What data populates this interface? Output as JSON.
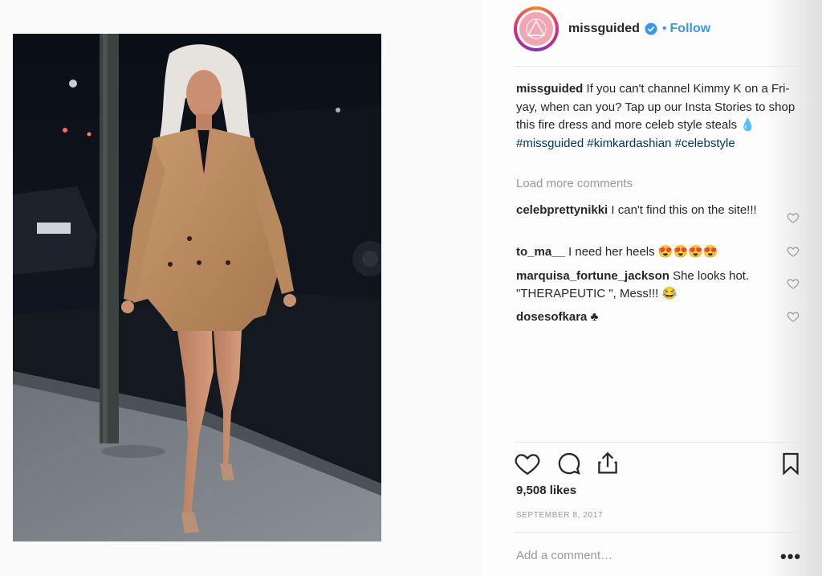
{
  "post": {
    "username": "missguided",
    "follow_label": "Follow",
    "separator": "•",
    "caption": {
      "username": "missguided",
      "text": " If you can't channel Kimmy K on a Fri-yay, when can you? Tap up our Insta Stories to shop this fire dress and more celeb style steals ",
      "emoji": "💧",
      "hashtags": [
        "#missguided",
        "#kimkardashian",
        "#celebstyle"
      ]
    },
    "load_more_label": "Load more comments",
    "comments": [
      {
        "username": "celebprettynikki",
        "text": " I can't find this on the site!!!"
      },
      {
        "username": "to_ma__",
        "text": " I need her heels 😍😍😍😍"
      },
      {
        "username": "marquisa_fortune_jackson",
        "text": " She looks hot. \"THERAPEUTIC \", Mess!!! 😂"
      },
      {
        "username": "dosesofkara",
        "text": " ♣"
      }
    ],
    "likes": "9,508 likes",
    "date": "SEPTEMBER 8, 2017",
    "add_comment_placeholder": "Add a comment…",
    "more_label": "•••"
  },
  "icons": {
    "like": "heart-icon",
    "comment": "comment-icon",
    "share": "share-icon",
    "save": "bookmark-icon",
    "verified": "verified-badge-icon",
    "comment_like": "heart-icon"
  },
  "colors": {
    "link": "#3897f0",
    "hashtag": "#003569",
    "muted": "#999999",
    "text": "#262626"
  }
}
